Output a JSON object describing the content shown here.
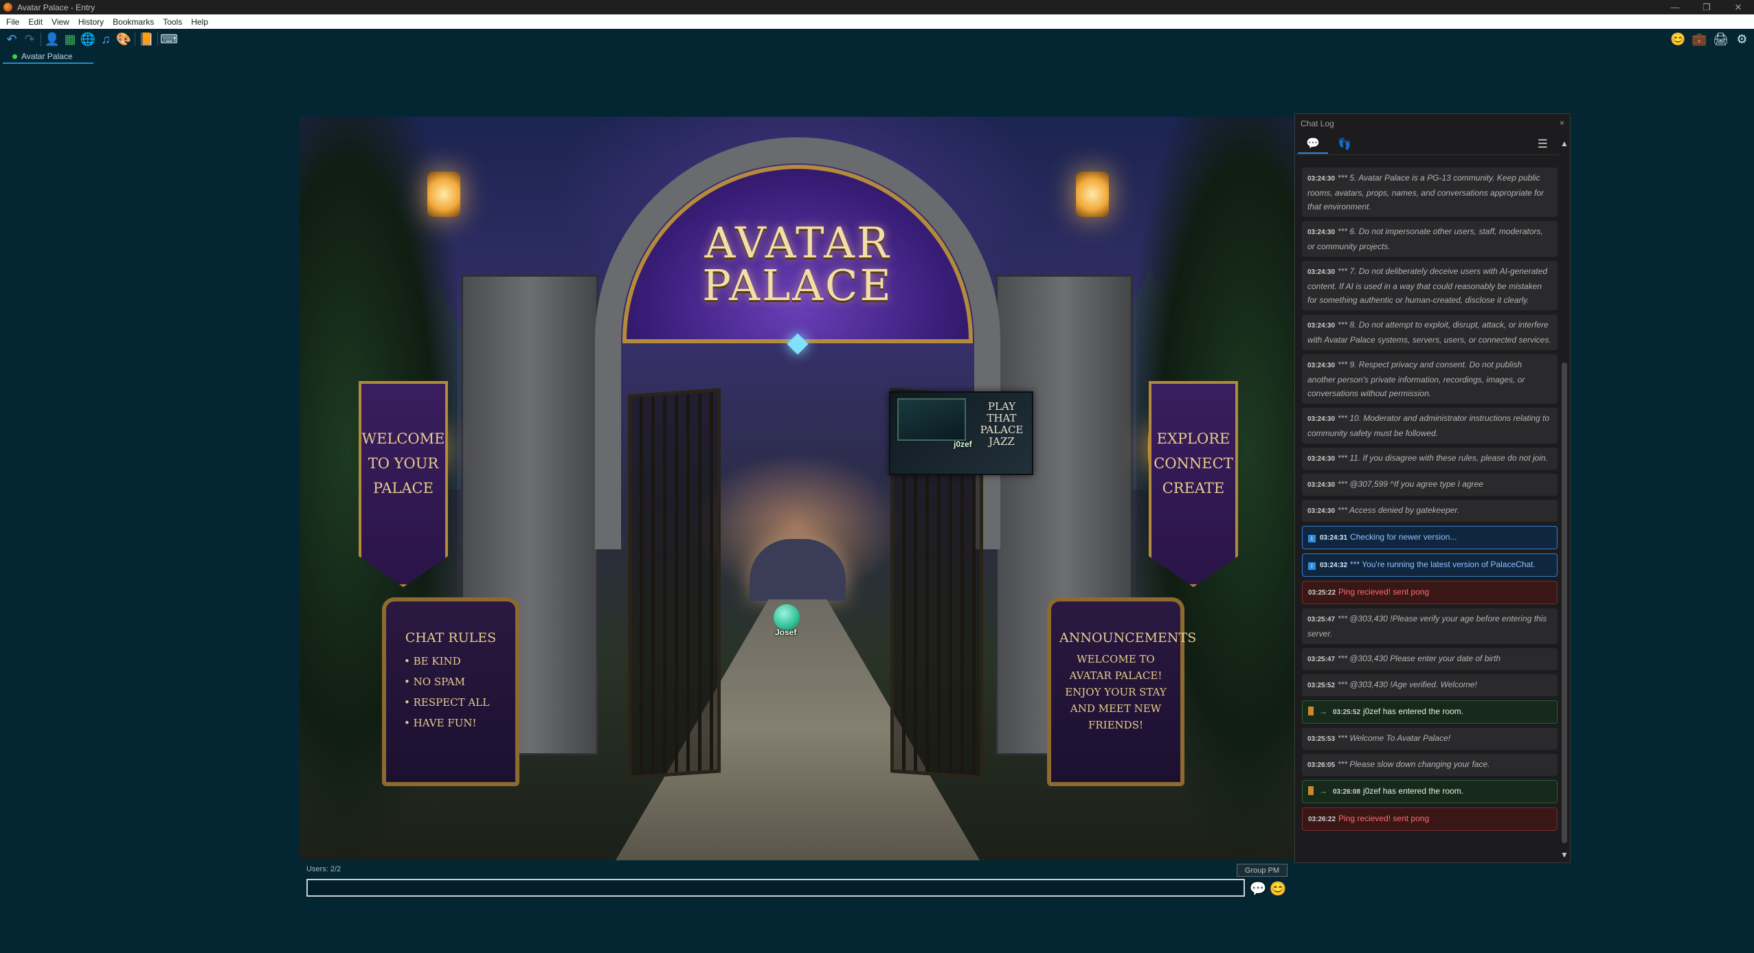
{
  "window": {
    "title": "Avatar Palace - Entry",
    "controls": [
      "—",
      "❐",
      "✕"
    ]
  },
  "menu": [
    "File",
    "Edit",
    "View",
    "History",
    "Bookmarks",
    "Tools",
    "Help"
  ],
  "toolbar": {
    "left_icons": [
      "back-icon",
      "forward-icon",
      "user-icon",
      "map-icon",
      "globe-icon",
      "music-icon",
      "palette-icon",
      "book-icon",
      "keyboard-icon"
    ],
    "right_icons": [
      "smiley-icon",
      "suitcase-icon",
      "printer-icon",
      "settings-icon"
    ]
  },
  "tab": {
    "label": "Avatar Palace"
  },
  "room": {
    "arch_title": "AVATAR PALACE",
    "left_banner": "WELCOME\nTO YOUR\nPALACE",
    "right_banner": "EXPLORE\nCONNECT\nCREATE",
    "rules_sign": {
      "title": "CHAT RULES",
      "items": [
        "BE KIND",
        "NO SPAM",
        "RESPECT ALL",
        "HAVE FUN!"
      ]
    },
    "announce_sign": {
      "title": "ANNOUNCEMENTS",
      "body": "WELCOME TO AVATAR PALACE! ENJOY YOUR STAY AND MEET NEW FRIENDS!"
    },
    "prop_title": "PLAY THAT PALACE JAZZ",
    "avatars": [
      {
        "name": "j0zef"
      },
      {
        "name": "Josef"
      }
    ]
  },
  "footer": {
    "users": "Users: 2/2",
    "group_pm": "Group PM",
    "input_value": ""
  },
  "chatlog": {
    "title": "Chat Log",
    "close": "×",
    "messages": [
      {
        "type": "system",
        "time": "03:24:30",
        "text": "*** 5. Avatar Palace is a PG-13 community. Keep public rooms, avatars, props, names, and conversations appropriate for that environment."
      },
      {
        "type": "system",
        "time": "03:24:30",
        "text": "*** 6. Do not impersonate other users, staff, moderators, or community projects."
      },
      {
        "type": "system",
        "time": "03:24:30",
        "text": "*** 7. Do not deliberately deceive users with AI-generated content. If AI is used in a way that could reasonably be mistaken for something authentic or human-created, disclose it clearly."
      },
      {
        "type": "system",
        "time": "03:24:30",
        "text": "*** 8. Do not attempt to exploit, disrupt, attack, or interfere with Avatar Palace systems, servers, users, or connected services."
      },
      {
        "type": "system",
        "time": "03:24:30",
        "text": "*** 9. Respect privacy and consent. Do not publish another person's private information, recordings, images, or conversations without permission."
      },
      {
        "type": "system",
        "time": "03:24:30",
        "text": "*** 10. Moderator and administrator instructions relating to community safety must be followed."
      },
      {
        "type": "system",
        "time": "03:24:30",
        "text": "*** 11. If you disagree with these rules, please do not join."
      },
      {
        "type": "system",
        "time": "03:24:30",
        "text": "*** @307,599 ^If you agree type I agree"
      },
      {
        "type": "system",
        "time": "03:24:30",
        "text": "*** Access denied by gatekeeper."
      },
      {
        "type": "info",
        "time": "03:24:31",
        "text": "Checking for newer version..."
      },
      {
        "type": "info",
        "time": "03:24:32",
        "text": "*** You're running the latest version of PalaceChat."
      },
      {
        "type": "ping",
        "time": "03:25:22",
        "text": "Ping recieved! sent pong"
      },
      {
        "type": "system",
        "time": "03:25:47",
        "text": "*** @303,430 !Please verify your age before entering this server."
      },
      {
        "type": "system",
        "time": "03:25:47",
        "text": "*** @303,430 Please enter your date of birth"
      },
      {
        "type": "system",
        "time": "03:25:52",
        "text": "*** @303,430 !Age verified. Welcome!"
      },
      {
        "type": "enter",
        "time": "03:25:52",
        "text": "j0zef has entered the room."
      },
      {
        "type": "system",
        "time": "03:25:53",
        "text": "*** Welcome To Avatar Palace!"
      },
      {
        "type": "system",
        "time": "03:26:05",
        "text": "*** Please slow down changing your face."
      },
      {
        "type": "enter",
        "time": "03:26:08",
        "text": "j0zef has entered the room."
      },
      {
        "type": "ping",
        "time": "03:26:22",
        "text": "Ping recieved! sent pong"
      }
    ]
  }
}
